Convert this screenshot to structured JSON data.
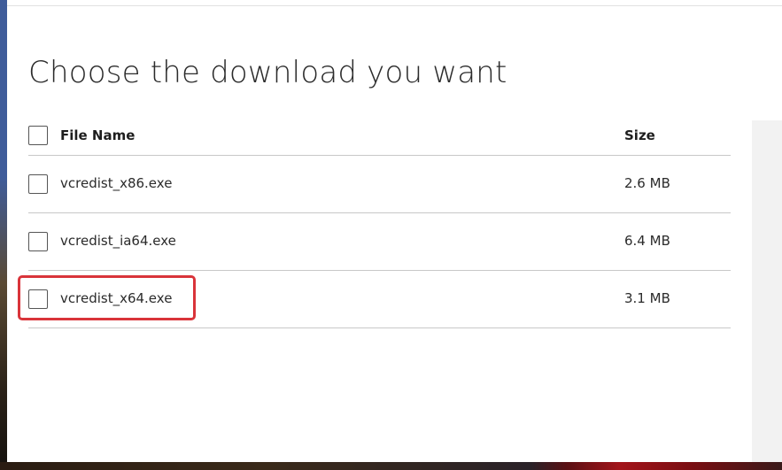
{
  "page": {
    "title": "Choose the download you want"
  },
  "table": {
    "columns": {
      "file_name": "File Name",
      "size": "Size"
    },
    "rows": [
      {
        "file_name": "vcredist_x86.exe",
        "size": "2.6 MB",
        "checked": false
      },
      {
        "file_name": "vcredist_ia64.exe",
        "size": "6.4 MB",
        "checked": false
      },
      {
        "file_name": "vcredist_x64.exe",
        "size": "3.1 MB",
        "checked": false,
        "highlighted": true
      }
    ]
  },
  "colors": {
    "highlight_border": "#d9343a",
    "text": "#2b2b2b",
    "divider": "#c8c8c8"
  }
}
